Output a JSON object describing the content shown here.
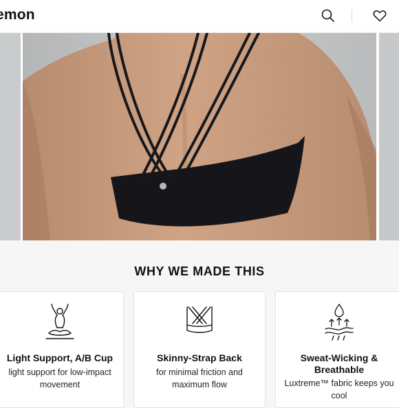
{
  "header": {
    "brand": "emon",
    "icons": [
      "search-icon",
      "heart-icon"
    ]
  },
  "gallery": {
    "slides": 3,
    "active_index": 1
  },
  "why": {
    "title": "WHY WE MADE THIS",
    "features": [
      {
        "icon": "yoga-pose-icon",
        "title": "Light Support, A/B Cup",
        "description": "light support for low-impact movement"
      },
      {
        "icon": "strappy-bra-icon",
        "title": "Skinny-Strap Back",
        "description": "for minimal friction and maximum flow"
      },
      {
        "icon": "sweat-wicking-icon",
        "title": "Sweat-Wicking & Breathable",
        "description": "Luxtreme™ fabric keeps you cool"
      }
    ]
  }
}
